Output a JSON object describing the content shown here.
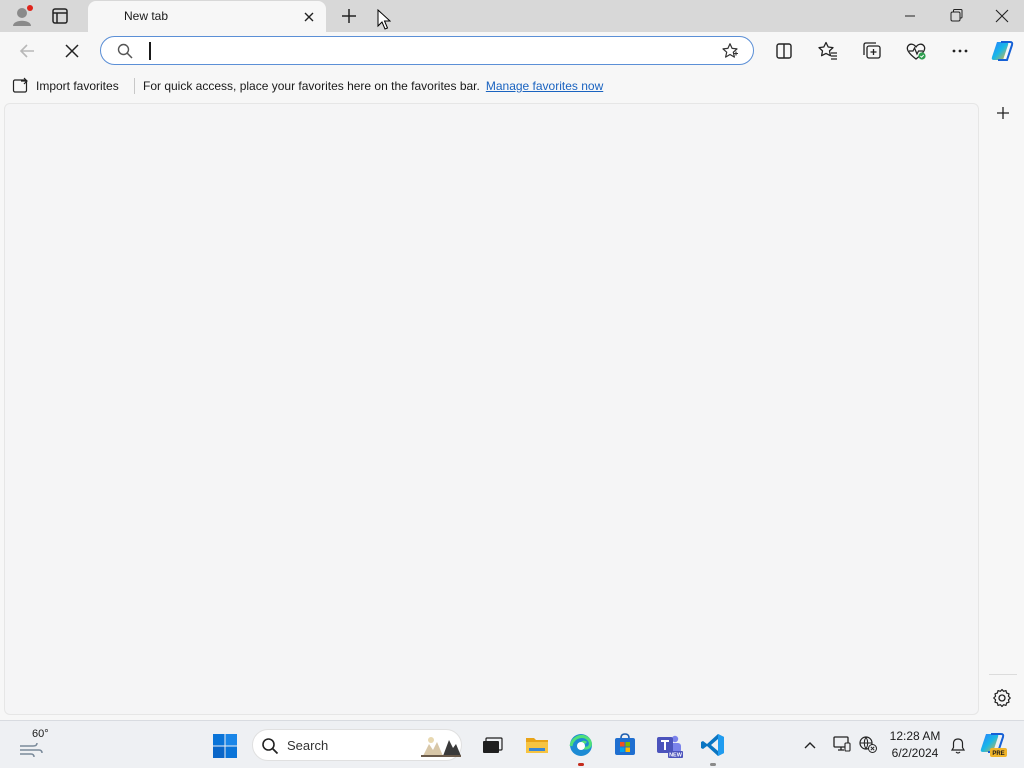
{
  "browser": {
    "tab": {
      "title": "New tab"
    },
    "address_bar": {
      "value": "",
      "placeholder": ""
    }
  },
  "favorites_bar": {
    "import_label": "Import favorites",
    "message": "For quick access, place your favorites here on the favorites bar.",
    "link_label": "Manage favorites now"
  },
  "taskbar": {
    "weather_temp": "60°",
    "search_label": "Search",
    "teams_badge": "NEW",
    "copilot_badge": "PRE",
    "clock": {
      "time": "12:28 AM",
      "date": "6/2/2024"
    }
  },
  "icons": {
    "profile": "profile-icon",
    "tab_actions": "tab-actions-icon",
    "close": "close-icon",
    "new_tab": "plus-icon",
    "back": "arrow-left-icon",
    "stop": "stop-icon",
    "search": "search-icon",
    "favorite": "star-icon",
    "split_screen": "split-screen-icon",
    "favorites": "favorites-icon",
    "collections": "collections-icon",
    "browser_essentials": "heart-pulse-icon",
    "more": "more-icon",
    "copilot": "copilot-icon",
    "settings": "gear-icon"
  },
  "colors": {
    "tabstrip": "#d8d8d8",
    "accent_link": "#1a63c0",
    "address_border": "#5b8fd6",
    "profile_dot": "#e0241b",
    "windows_blue": "#0078d4"
  }
}
